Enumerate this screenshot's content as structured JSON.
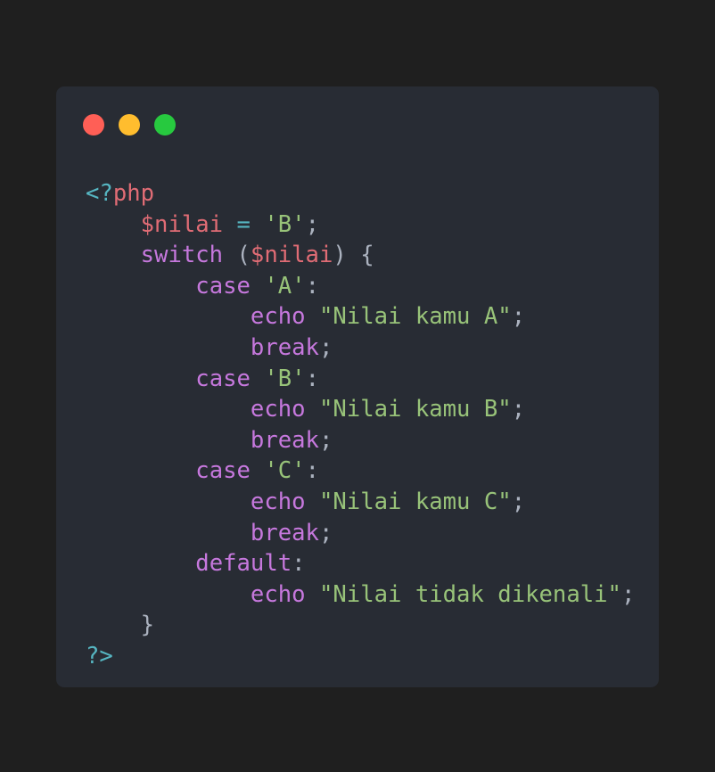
{
  "window": {
    "controls": [
      {
        "name": "close",
        "color": "#ff5f56"
      },
      {
        "name": "minimize",
        "color": "#ffbd2e"
      },
      {
        "name": "maximize",
        "color": "#27c93f"
      }
    ]
  },
  "code": {
    "language": "php",
    "lines": [
      [
        {
          "t": "tag",
          "v": "<?"
        },
        {
          "t": "php",
          "v": "php"
        }
      ],
      [
        {
          "t": "punc",
          "v": "    "
        },
        {
          "t": "var",
          "v": "$nilai"
        },
        {
          "t": "punc",
          "v": " "
        },
        {
          "t": "op",
          "v": "="
        },
        {
          "t": "punc",
          "v": " "
        },
        {
          "t": "str",
          "v": "'B'"
        },
        {
          "t": "punc",
          "v": ";"
        }
      ],
      [
        {
          "t": "punc",
          "v": "    "
        },
        {
          "t": "kw",
          "v": "switch"
        },
        {
          "t": "punc",
          "v": " ("
        },
        {
          "t": "var",
          "v": "$nilai"
        },
        {
          "t": "punc",
          "v": ") {"
        }
      ],
      [
        {
          "t": "punc",
          "v": "        "
        },
        {
          "t": "kw",
          "v": "case"
        },
        {
          "t": "punc",
          "v": " "
        },
        {
          "t": "str",
          "v": "'A'"
        },
        {
          "t": "punc",
          "v": ":"
        }
      ],
      [
        {
          "t": "punc",
          "v": "            "
        },
        {
          "t": "kw",
          "v": "echo"
        },
        {
          "t": "punc",
          "v": " "
        },
        {
          "t": "str",
          "v": "\"Nilai kamu A\""
        },
        {
          "t": "punc",
          "v": ";"
        }
      ],
      [
        {
          "t": "punc",
          "v": "            "
        },
        {
          "t": "kw",
          "v": "break"
        },
        {
          "t": "punc",
          "v": ";"
        }
      ],
      [
        {
          "t": "punc",
          "v": "        "
        },
        {
          "t": "kw",
          "v": "case"
        },
        {
          "t": "punc",
          "v": " "
        },
        {
          "t": "str",
          "v": "'B'"
        },
        {
          "t": "punc",
          "v": ":"
        }
      ],
      [
        {
          "t": "punc",
          "v": "            "
        },
        {
          "t": "kw",
          "v": "echo"
        },
        {
          "t": "punc",
          "v": " "
        },
        {
          "t": "str",
          "v": "\"Nilai kamu B\""
        },
        {
          "t": "punc",
          "v": ";"
        }
      ],
      [
        {
          "t": "punc",
          "v": "            "
        },
        {
          "t": "kw",
          "v": "break"
        },
        {
          "t": "punc",
          "v": ";"
        }
      ],
      [
        {
          "t": "punc",
          "v": "        "
        },
        {
          "t": "kw",
          "v": "case"
        },
        {
          "t": "punc",
          "v": " "
        },
        {
          "t": "str",
          "v": "'C'"
        },
        {
          "t": "punc",
          "v": ":"
        }
      ],
      [
        {
          "t": "punc",
          "v": "            "
        },
        {
          "t": "kw",
          "v": "echo"
        },
        {
          "t": "punc",
          "v": " "
        },
        {
          "t": "str",
          "v": "\"Nilai kamu C\""
        },
        {
          "t": "punc",
          "v": ";"
        }
      ],
      [
        {
          "t": "punc",
          "v": "            "
        },
        {
          "t": "kw",
          "v": "break"
        },
        {
          "t": "punc",
          "v": ";"
        }
      ],
      [
        {
          "t": "punc",
          "v": "        "
        },
        {
          "t": "kw",
          "v": "default"
        },
        {
          "t": "punc",
          "v": ":"
        }
      ],
      [
        {
          "t": "punc",
          "v": "            "
        },
        {
          "t": "kw",
          "v": "echo"
        },
        {
          "t": "punc",
          "v": " "
        },
        {
          "t": "str",
          "v": "\"Nilai tidak dikenali\""
        },
        {
          "t": "punc",
          "v": ";"
        }
      ],
      [
        {
          "t": "punc",
          "v": "    }"
        }
      ],
      [
        {
          "t": "tag",
          "v": "?>"
        }
      ]
    ]
  }
}
